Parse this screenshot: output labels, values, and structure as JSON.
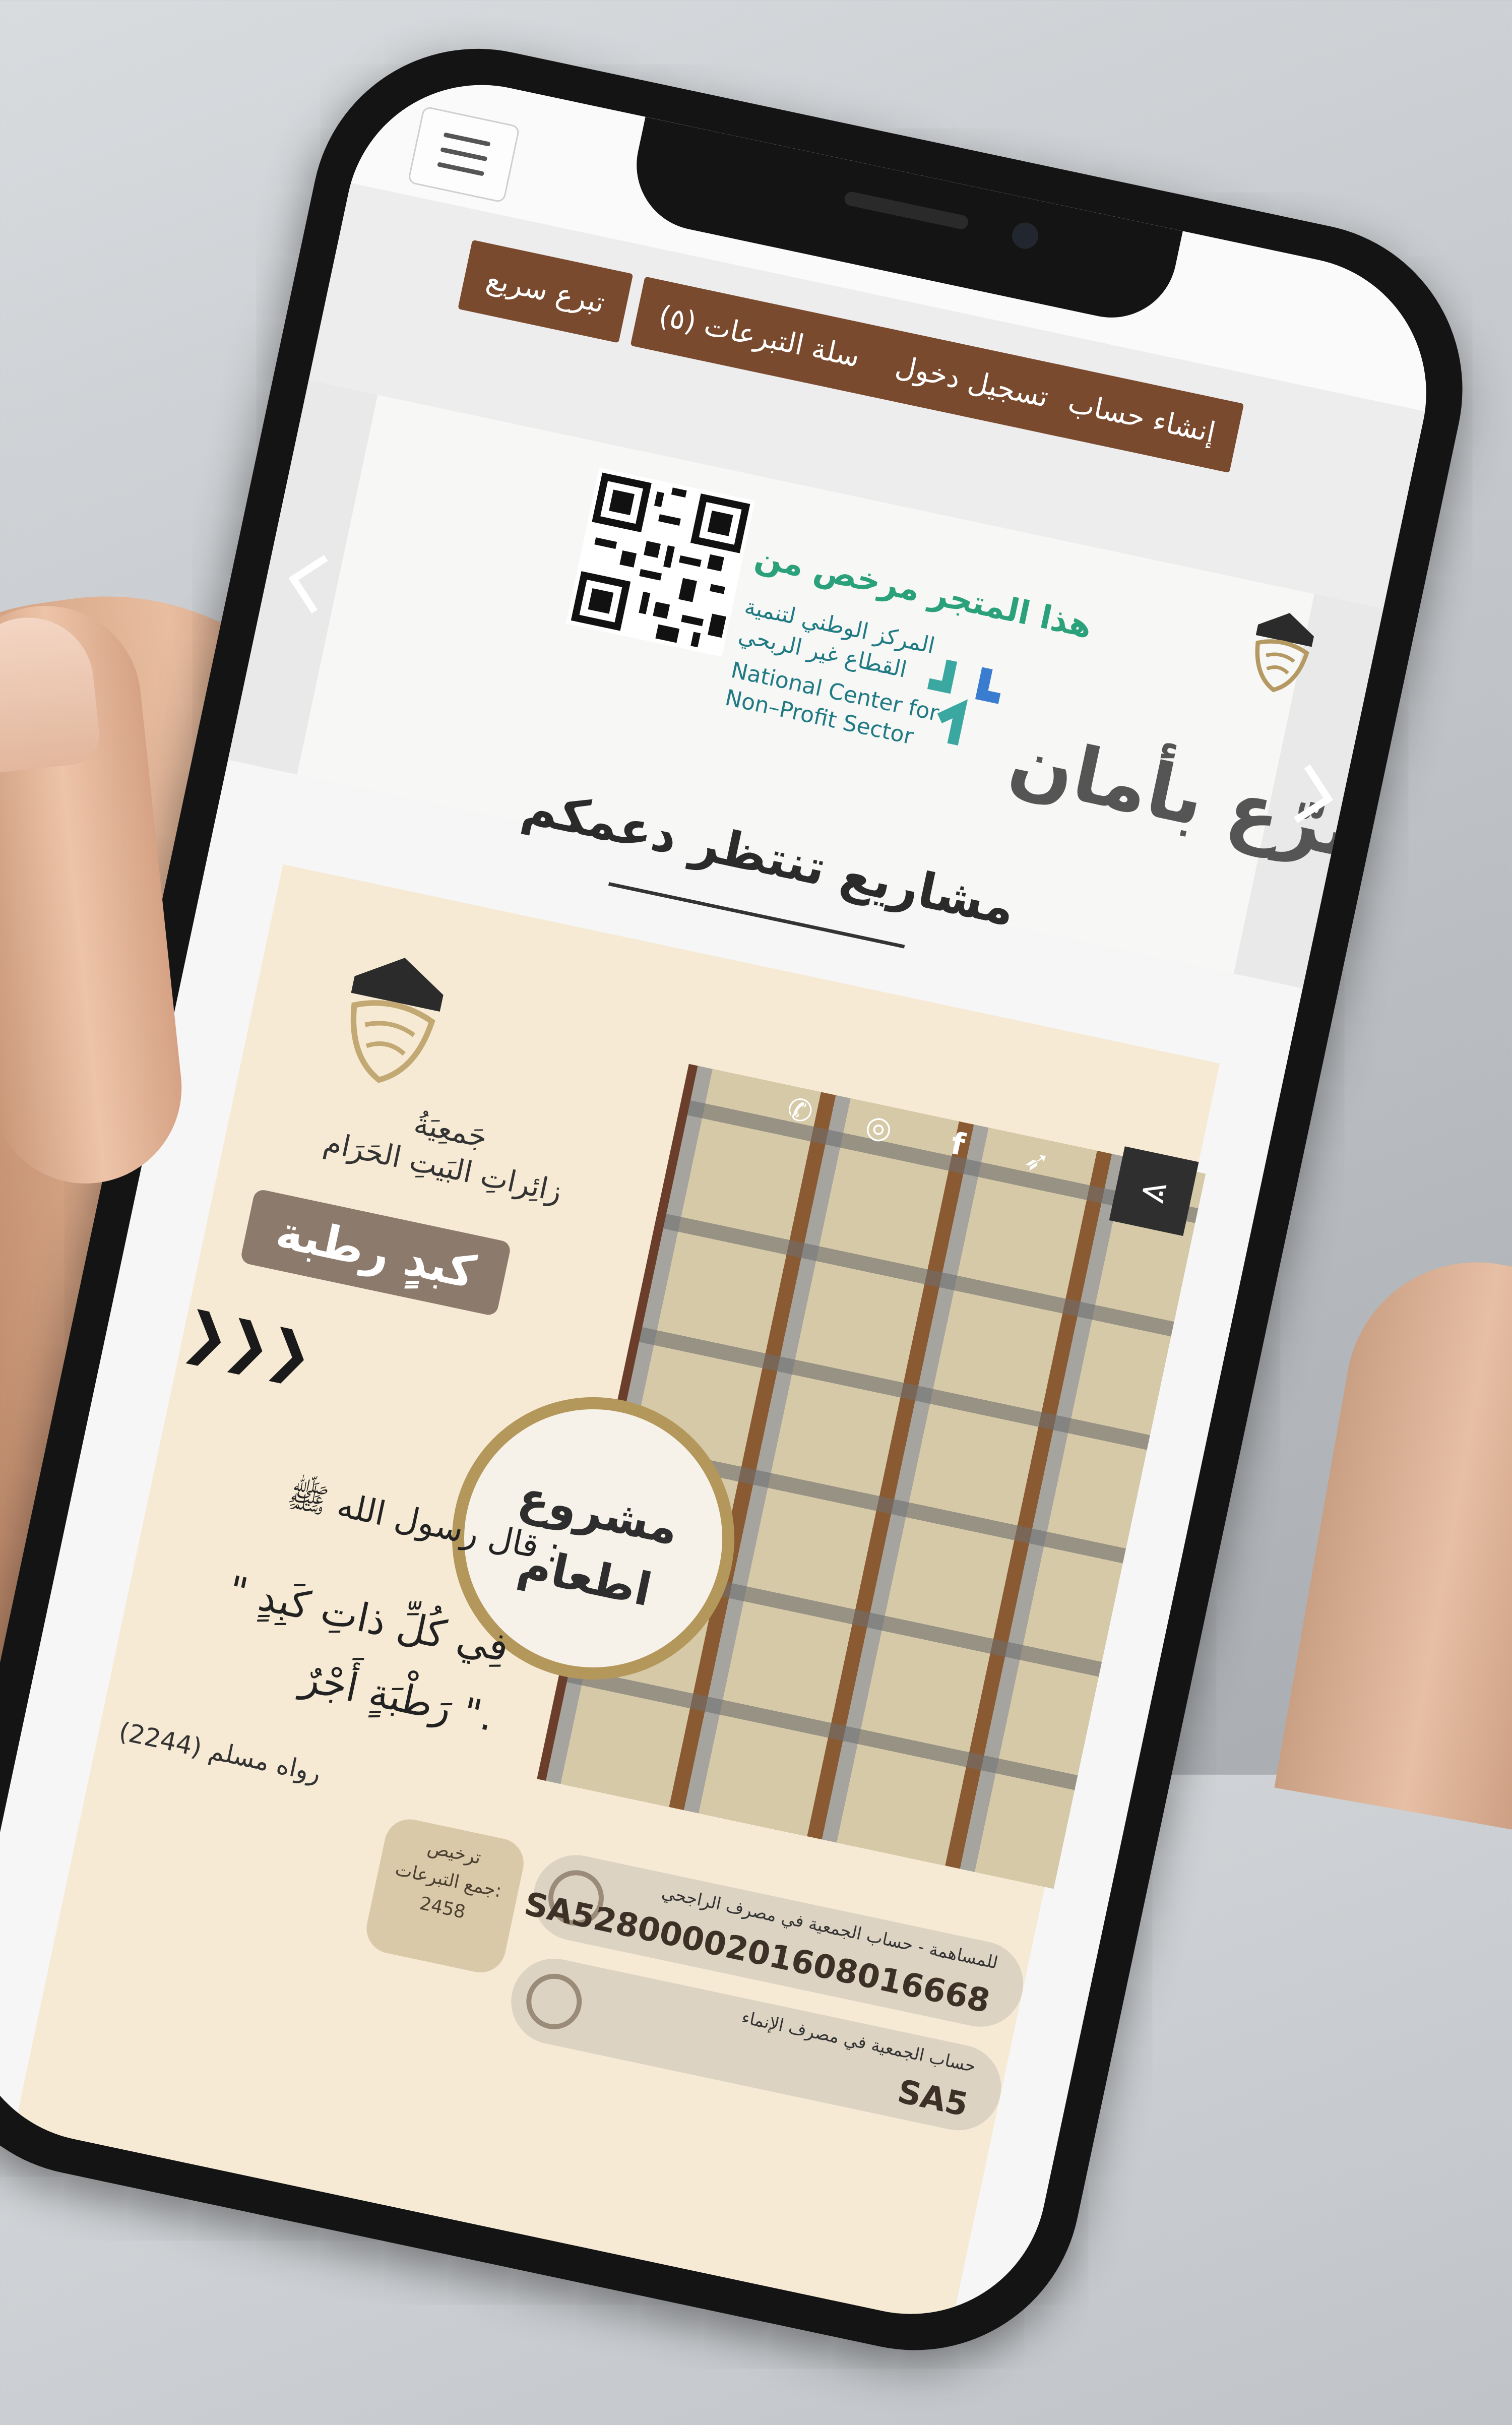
{
  "nav": {
    "quick_donate": "تبرع سريع",
    "cart": "سلة التبرعات (٥)",
    "login": "تسجيل دخول",
    "register": "إنشاء حساب"
  },
  "banner": {
    "license_title": "هذا المتجر مرخص من",
    "center_name_ar_1": "المركز الوطني لتنمية",
    "center_name_ar_2": "القطاع غير الربحي",
    "center_name_en_1": "National Center for",
    "center_name_en_2": "Non–Profit Sector",
    "tagline": "تبرّع بأمان"
  },
  "section": {
    "title": "مشاريع تنتظر دعمكم"
  },
  "card": {
    "assoc_line1": "جَمعِيَةُ",
    "assoc_line2": "زائِراتِ البَيتِ الحَرَام",
    "project_badge": "كبدٍ رطبة",
    "arrows": "❯❯❯",
    "circle_line1": "مشروع",
    "circle_line2": "اطعام",
    "hadith_intro": "قال رسول الله ﷺ :",
    "hadith_line1": "\" فِي كُلِّ ذاتِ كَبِدٍ",
    "hadith_line2": "رَطْبَةٍ أَجْرٌ \".",
    "hadith_source": "رواه مسلم (2244)",
    "license_line1": "ترخيص",
    "license_line2": "جمع التبرعات:",
    "license_number": "2458",
    "bank1_label": "للمساهمة - حساب الجمعية في مصرف الراجحي",
    "bank1_iban": "SA5280000201608016668",
    "bank2_label": "حساب الجمعية في مصرف الإنماء",
    "bank2_iban": "SA5"
  },
  "share": {
    "icons": [
      "whatsapp-icon",
      "instagram-icon",
      "facebook-icon",
      "twitter-icon",
      "share-icon"
    ]
  }
}
